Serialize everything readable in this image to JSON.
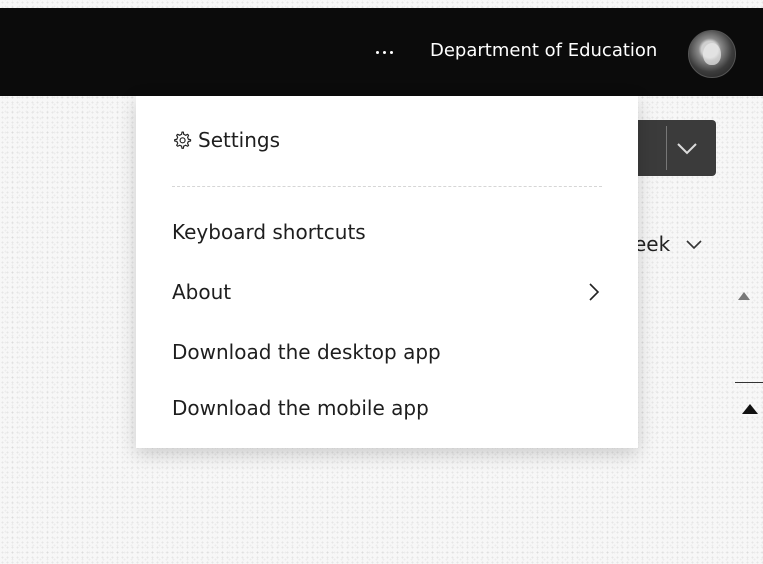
{
  "header": {
    "more_label": "···",
    "org_name": "Department of Education",
    "avatar_alt": "profile picture"
  },
  "menu": {
    "settings": "Settings",
    "items": [
      {
        "label": "Keyboard shortcuts",
        "has_submenu": false
      },
      {
        "label": "About",
        "has_submenu": true
      },
      {
        "label": "Download the desktop app",
        "has_submenu": false
      },
      {
        "label": "Download the mobile app",
        "has_submenu": false
      }
    ]
  },
  "background": {
    "view_selector_partial": "eek",
    "view_chevron": "∨"
  },
  "colors": {
    "topbar": "#0b0b0b",
    "menu_bg": "#ffffff",
    "text": "#1e1e1e"
  }
}
